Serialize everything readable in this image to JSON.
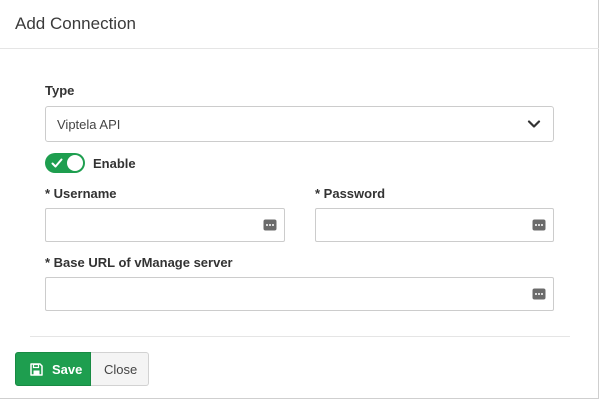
{
  "dialog": {
    "title": "Add Connection"
  },
  "form": {
    "type": {
      "label": "Type",
      "selected": "Viptela API"
    },
    "enable": {
      "label": "Enable",
      "checked": true
    },
    "username": {
      "label": "* Username",
      "value": ""
    },
    "password": {
      "label": "* Password",
      "value": ""
    },
    "base_url": {
      "label": "* Base URL of vManage server",
      "value": ""
    }
  },
  "footer": {
    "save_label": "Save",
    "close_label": "Close"
  },
  "colors": {
    "primary": "#1e9e4f",
    "border": "#cccccc"
  },
  "icons": {
    "select": "chevron-down-icon",
    "toggle": "check-icon",
    "password_fields": "password-manager-icon",
    "save": "floppy-disk-icon"
  }
}
